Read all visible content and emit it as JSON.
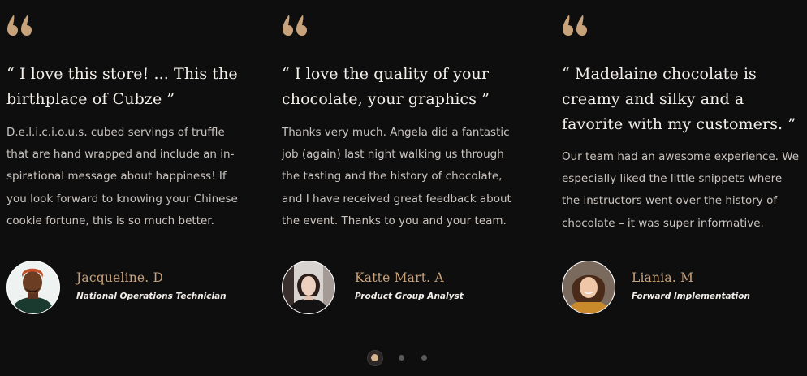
{
  "colors": {
    "background": "#0f0e0f",
    "accent_gold": "#c8a27a",
    "headline": "#f3efe9",
    "body": "#c9c4bf"
  },
  "testimonials": [
    {
      "icon": "quote-icon",
      "headline": "“ I love this store! ... This the birthplace of Cubze ”",
      "body": "D.e.l.i.c.i.o.u.s. cubed servings of truffle\nthat are hand wrapped and include an in-\nspirational message about happiness! If\nyou look forward to knowing your Chinese\ncookie fortune, this is so much better.",
      "author_name": "Jacqueline. D",
      "author_role": "National Operations Technician",
      "avatar": "avatar-photo"
    },
    {
      "icon": "quote-icon",
      "headline": "“ I love the quality of your chocolate, your graphics ”",
      "body": "Thanks very much. Angela did a fantastic\njob (again) last night walking us through\nthe tasting and the history of chocolate,\nand I have received great feedback about\nthe event. Thanks to you and your team.",
      "author_name": "Katte Mart. A",
      "author_role": "Product Group Analyst",
      "avatar": "avatar-photo"
    },
    {
      "icon": "quote-icon",
      "headline": "“ Madelaine chocolate is creamy and silky and a favorite with my customers. ”",
      "body": "Our team had an awesome experience. We\nespecially liked the little snippets where\nthe instructors went over the history of\nchocolate – it was super informative.",
      "author_name": "Liania. M",
      "author_role": "Forward Implementation",
      "avatar": "avatar-photo"
    }
  ],
  "pagination": {
    "total_pages": 3,
    "active_page": 1
  }
}
